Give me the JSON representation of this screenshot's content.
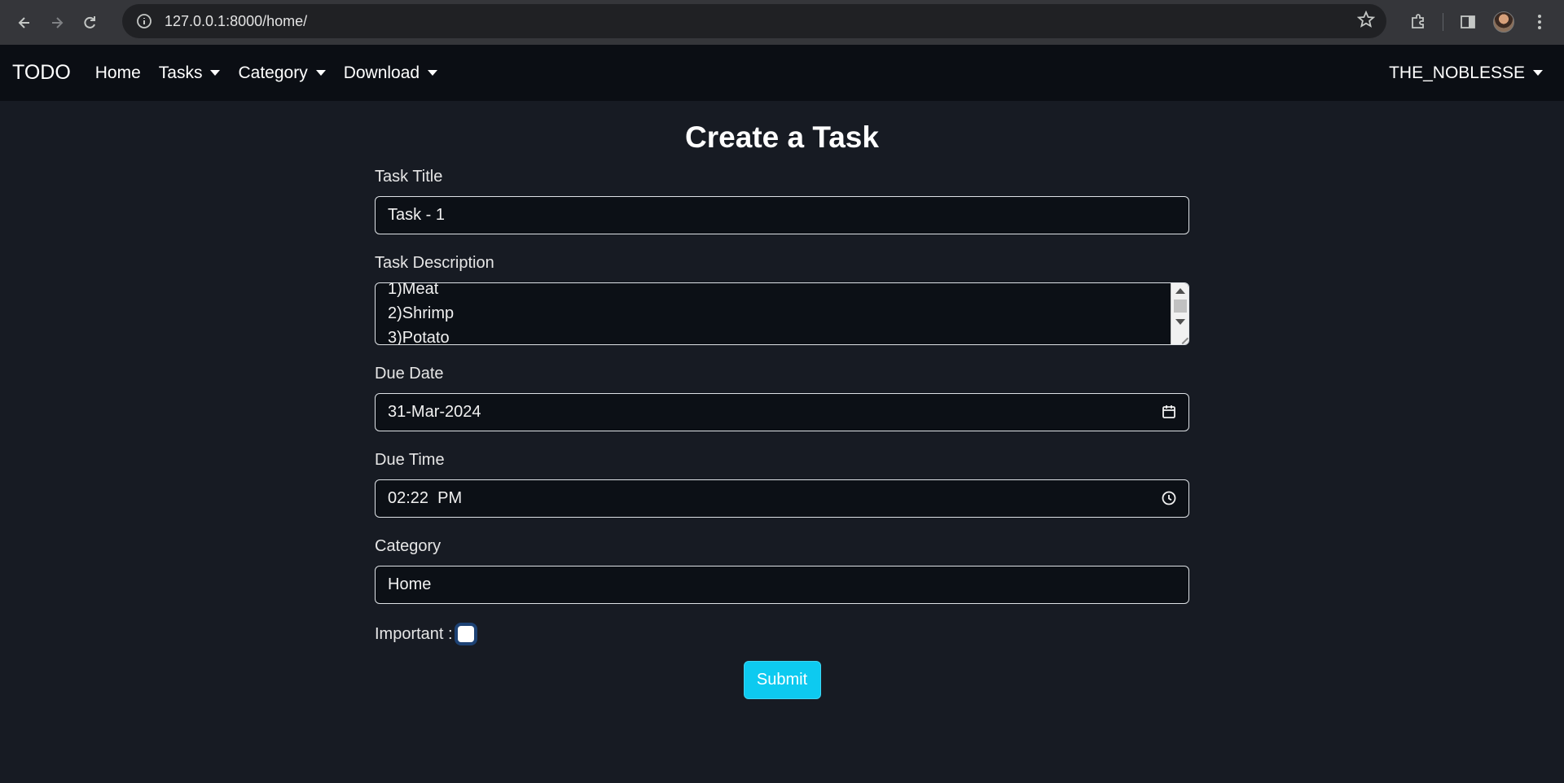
{
  "browser": {
    "url": "127.0.0.1:8000/home/"
  },
  "navbar": {
    "brand": "TODO",
    "items": [
      {
        "label": "Home"
      },
      {
        "label": "Tasks"
      },
      {
        "label": "Category"
      },
      {
        "label": "Download"
      }
    ],
    "user": "THE_NOBLESSE"
  },
  "form": {
    "title": "Create a Task",
    "task_title": {
      "label": "Task Title",
      "value": "Task - 1"
    },
    "task_description": {
      "label": "Task Description",
      "lines": [
        "1)Meat",
        "2)Shrimp",
        "3)Potato"
      ]
    },
    "due_date": {
      "label": "Due Date",
      "value": "31-Mar-2024"
    },
    "due_time": {
      "label": "Due Time",
      "value": "02:22  PM"
    },
    "category": {
      "label": "Category",
      "value": "Home"
    },
    "important_label": "Important :",
    "important_checked": false,
    "submit_label": "Submit"
  }
}
